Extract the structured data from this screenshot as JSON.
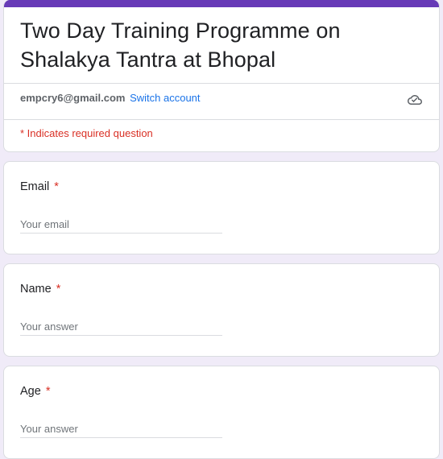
{
  "form": {
    "title": "Two Day Training Programme on Shalakya Tantra at Bhopal",
    "account_email": "empcry6@gmail.com",
    "switch_account": "Switch account",
    "required_note": "* Indicates required question",
    "accent_color": "#673ab7",
    "background_color": "#f0ebf8"
  },
  "questions": [
    {
      "label": "Email",
      "required_mark": "*",
      "placeholder": "Your email"
    },
    {
      "label": "Name",
      "required_mark": "*",
      "placeholder": "Your answer"
    },
    {
      "label": "Age",
      "required_mark": "*",
      "placeholder": "Your answer"
    }
  ],
  "icons": {
    "save_status": "cloud-check-icon"
  }
}
